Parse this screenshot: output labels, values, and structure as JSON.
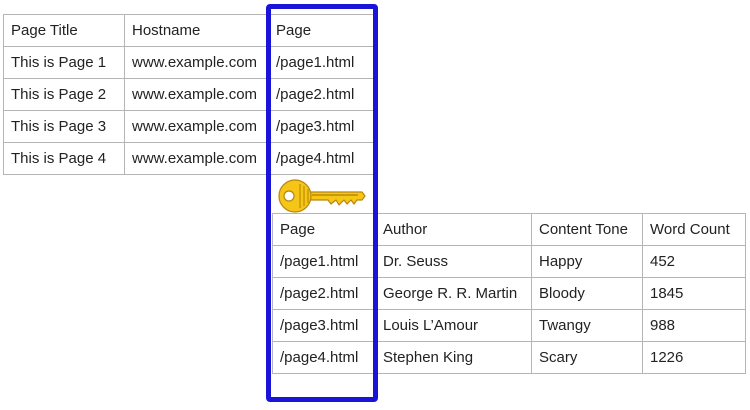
{
  "pages_table": {
    "columns": [
      "Page Title",
      "Hostname",
      "Page"
    ],
    "rows": [
      [
        "This is Page 1",
        "www.example.com",
        "/page1.html"
      ],
      [
        "This is Page 2",
        "www.example.com",
        "/page2.html"
      ],
      [
        "This is Page 3",
        "www.example.com",
        "/page3.html"
      ],
      [
        "This is Page 4",
        "www.example.com",
        "/page4.html"
      ]
    ]
  },
  "content_table": {
    "columns": [
      "Page",
      "Author",
      "Content Tone",
      "Word Count"
    ],
    "rows": [
      [
        "/page1.html",
        "Dr. Seuss",
        "Happy",
        "452"
      ],
      [
        "/page2.html",
        "George R. R. Martin",
        "Bloody",
        "1845"
      ],
      [
        "/page3.html",
        "Louis L’Amour",
        "Twangy",
        "988"
      ],
      [
        "/page4.html",
        "Stephen King",
        "Scary",
        "1226"
      ]
    ]
  },
  "join_key_icon": "key-icon",
  "colors": {
    "highlight": "#1a14d8",
    "key": "#f5c518",
    "border": "#b5b5b5"
  }
}
